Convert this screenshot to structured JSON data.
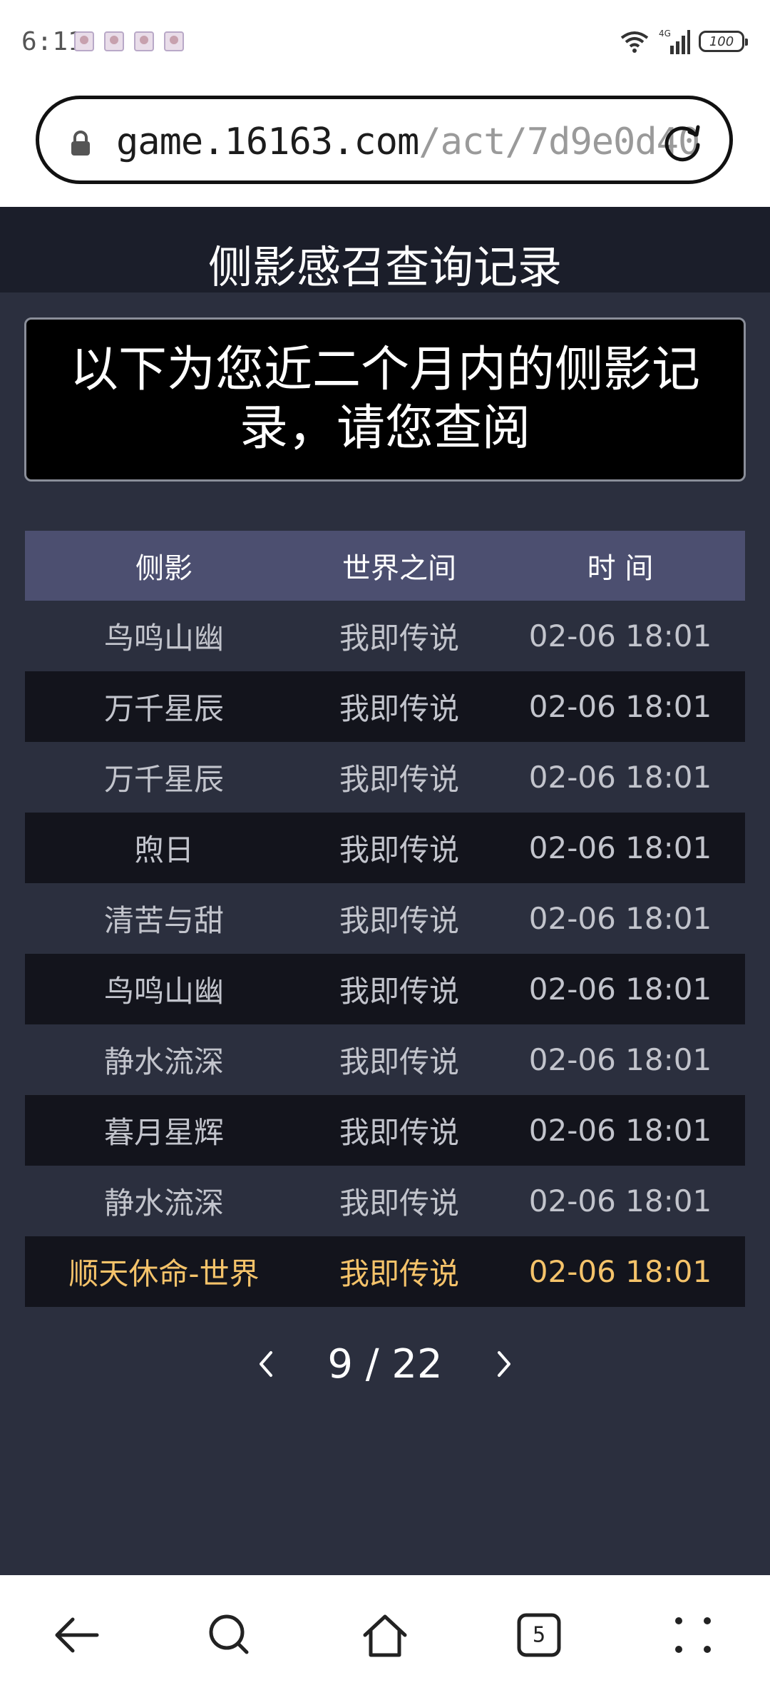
{
  "status_bar": {
    "time": "6:11",
    "network": "4G",
    "battery": "100"
  },
  "browser": {
    "url_domain": "game.16163.com",
    "url_path": "/act/7d9e0d40",
    "icons": [
      "lock-icon",
      "reload-icon"
    ]
  },
  "page": {
    "title": "侧影感召查询记录",
    "notice": "以下为您近二个月内的侧影记录，请您查阅",
    "table": {
      "headers": [
        "侧影",
        "世界之间",
        "时 间"
      ],
      "rows": [
        [
          "鸟鸣山幽",
          "我即传说",
          "02-06 18:01"
        ],
        [
          "万千星辰",
          "我即传说",
          "02-06 18:01"
        ],
        [
          "万千星辰",
          "我即传说",
          "02-06 18:01"
        ],
        [
          "煦日",
          "我即传说",
          "02-06 18:01"
        ],
        [
          "清苦与甜",
          "我即传说",
          "02-06 18:01"
        ],
        [
          "鸟鸣山幽",
          "我即传说",
          "02-06 18:01"
        ],
        [
          "静水流深",
          "我即传说",
          "02-06 18:01"
        ],
        [
          "暮月星辉",
          "我即传说",
          "02-06 18:01"
        ],
        [
          "静水流深",
          "我即传说",
          "02-06 18:01"
        ],
        [
          "顺天休命-世界",
          "我即传说",
          "02-06 18:01"
        ]
      ],
      "highlight_color": "#f5c36a"
    },
    "pagination": {
      "text": "9 / 22",
      "current": 9,
      "total": 22
    }
  },
  "bottom_nav": {
    "tab_count": "5",
    "icons": [
      "back-icon",
      "search-icon",
      "home-icon",
      "tabs-icon",
      "more-icon"
    ]
  }
}
